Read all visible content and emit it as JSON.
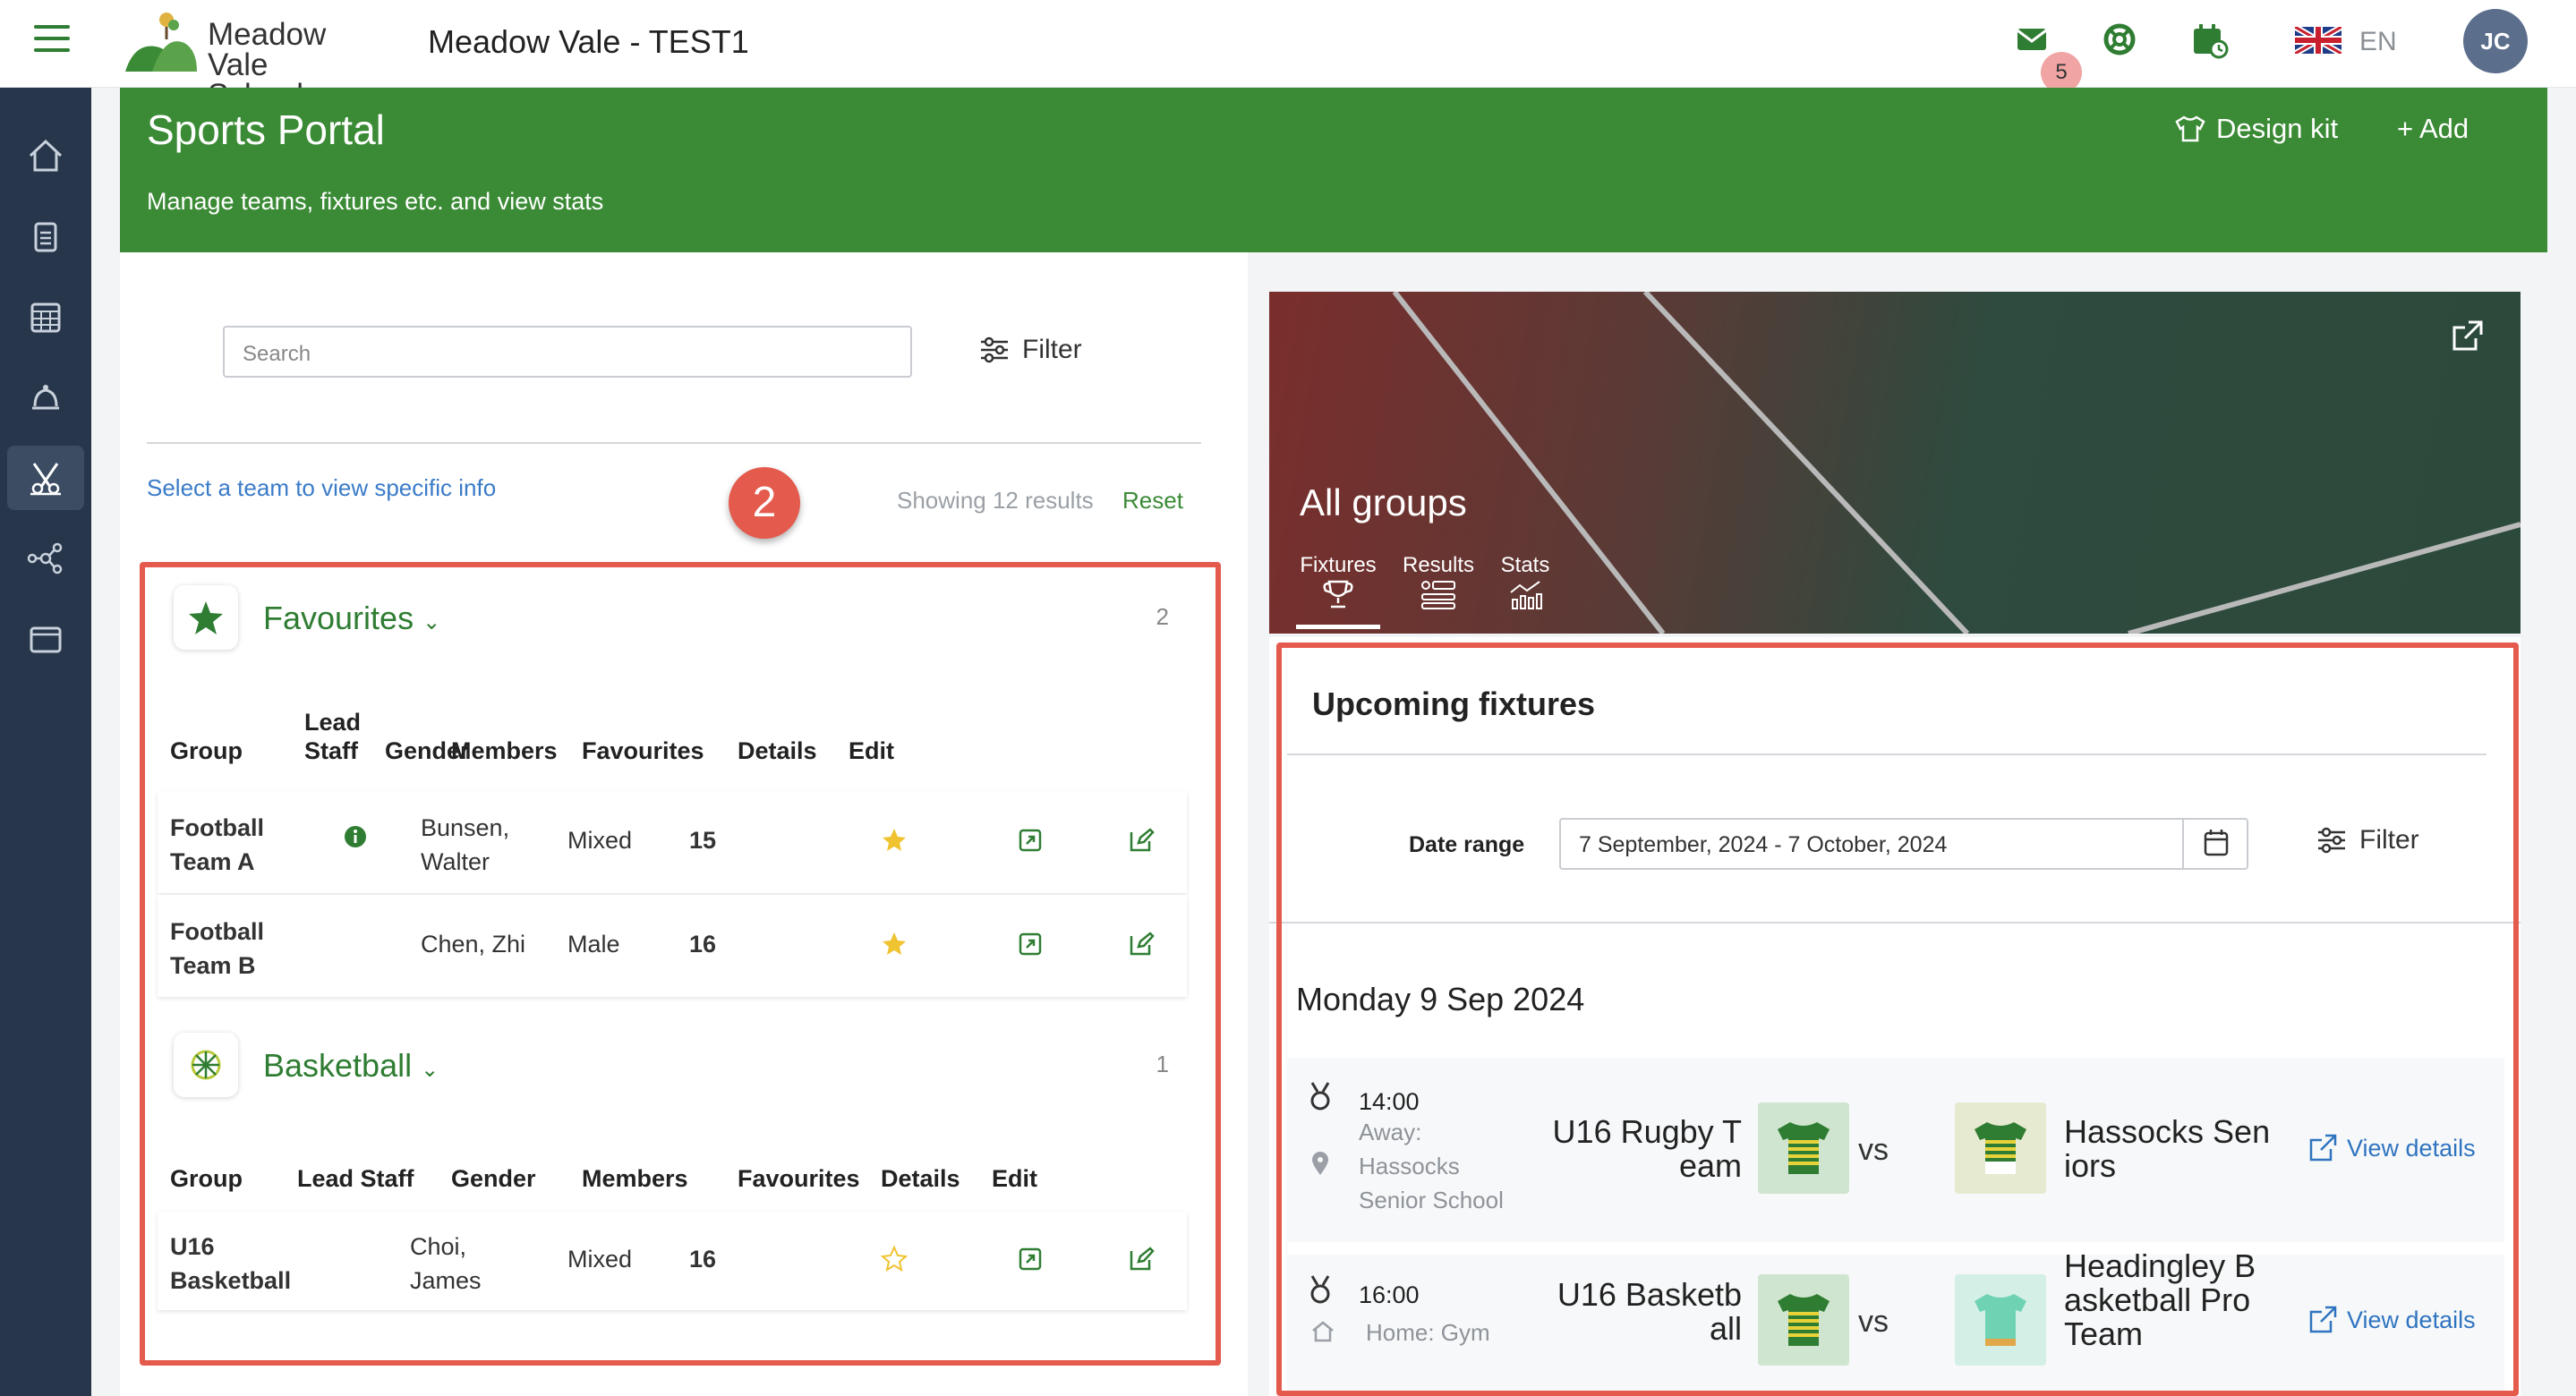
{
  "app": {
    "school_name_line1": "Meadow",
    "school_name_line2": "Vale School",
    "title": "Meadow Vale - TEST1",
    "mail_badge": "5",
    "language": "EN",
    "user_initials": "JC"
  },
  "sidebar": {
    "items": [
      {
        "icon": "home-icon"
      },
      {
        "icon": "clipboard-icon"
      },
      {
        "icon": "calendar-icon"
      },
      {
        "icon": "bell-icon"
      },
      {
        "icon": "sports-icon",
        "active": true
      },
      {
        "icon": "network-icon"
      },
      {
        "icon": "browser-icon"
      }
    ]
  },
  "header": {
    "title": "Sports Portal",
    "subtitle": "Manage teams, fixtures etc. and view stats",
    "design_kit": "Design kit",
    "add": "+ Add"
  },
  "teams": {
    "search_placeholder": "Search",
    "filter_label": "Filter",
    "hint": "Select a team to view specific info",
    "marker": "2",
    "showing": "Showing 12 results",
    "reset": "Reset",
    "groups": [
      {
        "name": "Favourites",
        "count": "2",
        "columns": {
          "group": "Group",
          "lead_staff_1": "Lead",
          "lead_staff_2": "Staff",
          "gender": "Gender",
          "members": "Members",
          "favourites": "Favourites",
          "details": "Details",
          "edit": "Edit"
        },
        "rows": [
          {
            "group_1": "Football",
            "group_2": "Team A",
            "lead_1": "Bunsen,",
            "lead_2": "Walter",
            "gender": "Mixed",
            "members": "15",
            "favourite": true
          },
          {
            "group_1": "Football",
            "group_2": "Team B",
            "lead_1": "Chen, Zhi",
            "lead_2": "",
            "gender": "Male",
            "members": "16",
            "favourite": true
          }
        ]
      },
      {
        "name": "Basketball",
        "count": "1",
        "columns": {
          "group": "Group",
          "lead_staff": "Lead Staff",
          "gender": "Gender",
          "members": "Members",
          "favourites": "Favourites",
          "details": "Details",
          "edit": "Edit"
        },
        "rows": [
          {
            "group_1": "U16",
            "group_2": "Basketball",
            "lead_1": "Choi,",
            "lead_2": "James",
            "gender": "Mixed",
            "members": "16",
            "favourite": false
          }
        ]
      }
    ]
  },
  "banner": {
    "title": "All groups",
    "tabs": [
      "Fixtures",
      "Results",
      "Stats"
    ]
  },
  "fixtures": {
    "title": "Upcoming fixtures",
    "date_range_label": "Date range",
    "date_range_value": "7 September, 2024 - 7 October, 2024",
    "filter_label": "Filter",
    "day": "Monday 9 Sep 2024",
    "matches": [
      {
        "time": "14:00",
        "location_1": "Away:",
        "location_2": "Hassocks",
        "location_3": "Senior School",
        "home_1": "U16 Rugby T",
        "home_2": "eam",
        "vs": "vs",
        "away_1": "Hassocks Sen",
        "away_2": "iors",
        "away_3": "",
        "view": "View details"
      },
      {
        "time": "16:00",
        "location_1": "Home: Gym",
        "home_1": "U16 Basketb",
        "home_2": "all",
        "vs": "vs",
        "away_1": "Headingley B",
        "away_2": "asketball Pro",
        "away_3": "Team",
        "view": "View details"
      }
    ]
  },
  "colors": {
    "brand_green": "#3b8b36",
    "sidebar": "#27364b",
    "highlight_red": "#e45a4c",
    "link_blue": "#2f74c0"
  }
}
